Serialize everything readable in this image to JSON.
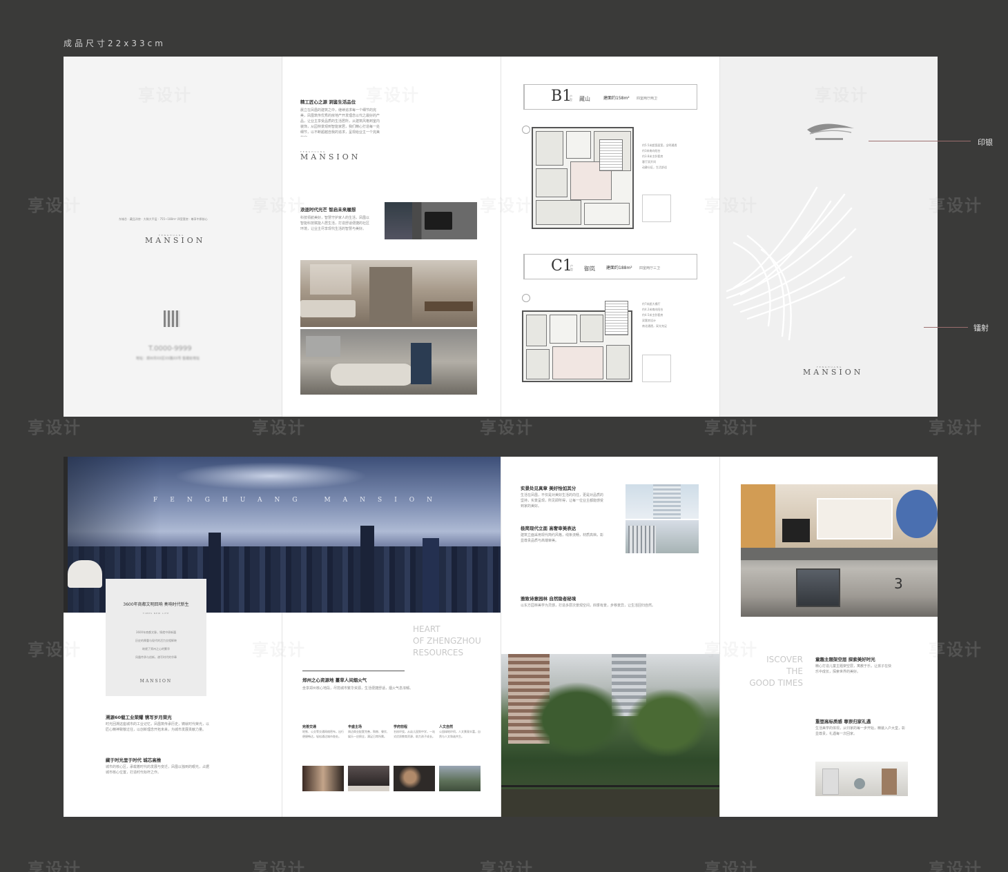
{
  "size_label": "成品尺寸22x33cm",
  "annotations": {
    "yinyin": "印银",
    "leishe": "镭射"
  },
  "brand": {
    "pre": "FENGHUANG",
    "name": "MANSION",
    "wide": "FENGHUANG MANSION"
  },
  "cover_left": {
    "tagline": "东城芯 · 藏品洋房 · 大稀大平层 · 755~188m² 四室套房 · 尊享中原核心",
    "phone": "T.0000-9999",
    "addr": "地址：郑州市XX区XX路XX号  售楼处地址"
  },
  "inner": {
    "h1": "精工匠心之源 洞鉴生活品位",
    "p1": "晨立在凤凰的建筑之中，继续追求每一个细节的完美，凤凰筑传优秀的房地产开发理念以代之最好的产品，让业主享受品质的生活居所，从建筑风格到室内装饰，从园林景观到智能家居，我们精心打造每一处细节，以不断超越自我的追求，呈现给业主一个完美的家。",
    "h2": "浪逐时代光芒 智启未来履想",
    "p2": "科技领航美好，智慧守护家人的生活，凤凰以智能科技赋能人居生活，打造舒适便捷的社区环境，让业主尽享现代生活的智慧与美好。"
  },
  "plan_b1": {
    "code": "B1",
    "type_label": "户型",
    "name": "藏山",
    "area": "建面约158m²",
    "rooms": "四室两厅两卫",
    "features": [
      "约5.5米超宽面宽，全明通透",
      "约3米南向阳台",
      "约3.8米主卧套房",
      "客厅双开间",
      "动静分区，生活舒适"
    ]
  },
  "plan_c1": {
    "code": "C1",
    "type_label": "户型",
    "name": "御岚",
    "area": "建面约188m²",
    "rooms": "四室两厅三卫",
    "features": [
      "约7米超大横厅",
      "约4.2米南向阳台",
      "约4.5米主卧套房",
      "双套房设计",
      "南北通透，采光充足"
    ]
  },
  "lower": {
    "headline": "3600年商都文明回响  奏响时代新生",
    "sub_en": "TIMES NEW LIFE",
    "card_lines": [
      "3600年商都文脉，铸就中原新篇",
      "历史的厚重与现代的活力交相辉映",
      "筑就了郑州之心的繁华",
      "凤凰传承与创新，谱写时代的华章"
    ],
    "h_a": "溯源60载工业荣耀 镌写岁月荣光",
    "p_a": "时光回溯这座城市的工业记忆，凤凰筑传承历史，铸就时代荣光，以匠心精神致敬过往，以创新理念开拓未来，为城市发展贡献力量。",
    "h_b": "藏于时光里于时代 城芯高推",
    "p_b": "城市的核心区，承载着时代的发展与变迁，凤凰以独到的眼光，占据城市核心位置，打造时代标杆之作。",
    "heart_en": [
      "HEART",
      "OF ZHENGZHOU",
      "RESOURCES"
    ],
    "h_c": "郑州之心资源地  蔓草人间烟火气",
    "p_c": "坐享郑州核心地段，尽揽城市繁华资源，生活便捷舒适，烟火气息浓郁。",
    "cols": [
      {
        "h": "完善交通",
        "p": "地铁、公交等交通网络密布，出行便捷畅达，轻松通达城市各处。"
      },
      {
        "h": "丰盛主场",
        "p": "周边商业配套完善，购物、餐饮、娱乐一应俱全，满足日常所需。"
      },
      {
        "h": "学府前程",
        "p": "名校环绕，从幼儿园到中学，一站式优质教育资源，助力孩子成长。"
      },
      {
        "h": "人文自然",
        "p": "公园绿地环伺，人文景观丰富，自然与人文和谐共生。"
      }
    ],
    "h_d": "实景处见真章 美好恰如其分",
    "p_d": "生活在凤凰，不仅是对美好生活的向往，更是对品质的坚持，实景呈现，所见即所得，让每一位业主都能感受到家的美好。",
    "h_e": "极简现代立面 高奢审美表达",
    "p_e": "建筑立面采用现代简约风格，线条流畅，材质高档，彰显尊贵品质与高端审美。",
    "h_f": "雅致诗意园林 自然隐者秘境",
    "p_f": "以东方园林美学为灵感，打造多层次景观空间，四季有景，步移景异，让生活回归自然。",
    "discover_en": [
      "ISCOVER",
      "THE",
      "GOOD TIMES"
    ],
    "h_g": "童趣主题架空层 探索美好时光",
    "p_g": "精心打造儿童主题架空层，寓教于乐，让孩子在快乐中成长，探索世界的美好。",
    "h_h": "重塑高标质感 尊崇归家礼遇",
    "p_h": "生活美学的体现，从归家的每一步开始，精装入户大堂，彰显尊贵，礼遇每一次回家。",
    "lobby_no": "3"
  },
  "watermark": "享设计"
}
